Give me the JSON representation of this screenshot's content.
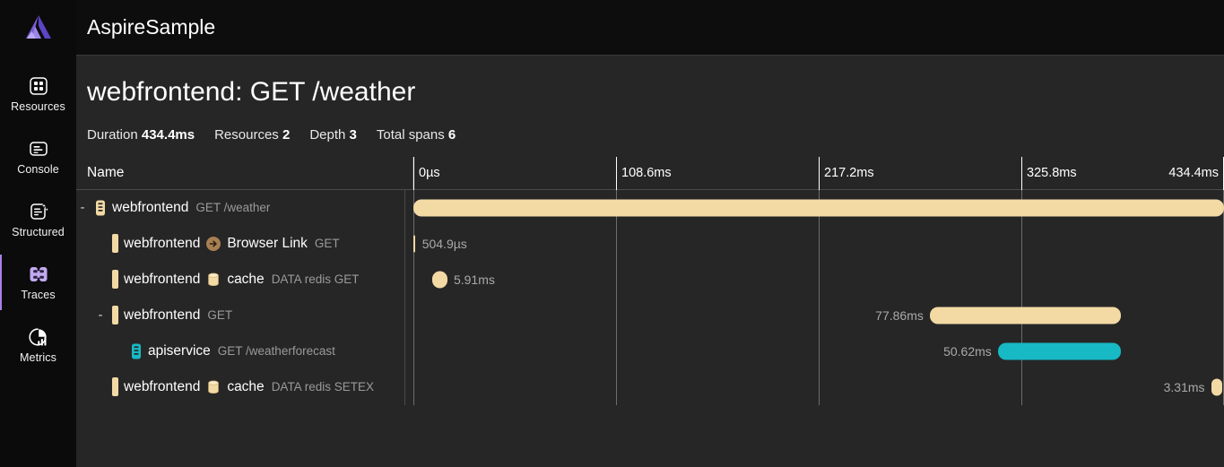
{
  "brand": {
    "logo_icon": "aspire-logo-icon",
    "accent": "#7c5cd6"
  },
  "sidebar": {
    "items": [
      {
        "label": "Resources",
        "icon": "resources-grid-icon",
        "active": false
      },
      {
        "label": "Console",
        "icon": "console-lines-icon",
        "active": false
      },
      {
        "label": "Structured",
        "icon": "structured-logs-sparkle-icon",
        "active": false
      },
      {
        "label": "Traces",
        "icon": "traces-link-icon",
        "active": true
      },
      {
        "label": "Metrics",
        "icon": "metrics-pie-chart-icon",
        "active": false
      }
    ]
  },
  "topbar": {
    "app_title": "AspireSample"
  },
  "page": {
    "title": "webfrontend: GET /weather",
    "meta": [
      {
        "label": "Duration",
        "value": "434.4ms"
      },
      {
        "label": "Resources",
        "value": "2"
      },
      {
        "label": "Depth",
        "value": "3"
      },
      {
        "label": "Total spans",
        "value": "6"
      }
    ]
  },
  "grid": {
    "name_column_header": "Name",
    "ticks": [
      "0µs",
      "108.6ms",
      "217.2ms",
      "325.8ms",
      "434.4ms"
    ],
    "colors": {
      "span_tan": "#f3d9a4",
      "span_teal": "#17b9c4",
      "arrow_brown": "#a87f52",
      "gridline": "#6d6d6d"
    },
    "rows": [
      {
        "expander": "-",
        "indent": 0,
        "icon": "resource-webfrontend-icon",
        "icon_kind": "service",
        "icon_color": "#f3d9a4",
        "name": "webfrontend",
        "mid_icon": null,
        "mid_icon_kind": null,
        "mid_name": null,
        "sub": "GET /weather",
        "bar": {
          "left_pct": 0.0,
          "width_pct": 100.0,
          "color": "#f3d9a4",
          "label": "",
          "label_side": "none"
        }
      },
      {
        "expander": "",
        "indent": 1,
        "icon": "span-bar-icon",
        "icon_kind": "spanbar",
        "icon_color": "#f3d9a4",
        "name": "webfrontend",
        "mid_icon": "arrow-right-circle-icon",
        "mid_icon_kind": "arrow",
        "mid_name": "Browser Link",
        "sub": "GET",
        "bar": {
          "left_pct": 0.0,
          "width_pct": 0.2,
          "color": "#f3d9a4",
          "label": "504.9µs",
          "label_side": "right"
        }
      },
      {
        "expander": "",
        "indent": 1,
        "icon": "span-bar-icon",
        "icon_kind": "spanbar",
        "icon_color": "#f3d9a4",
        "name": "webfrontend",
        "mid_icon": "redis-database-icon",
        "mid_icon_kind": "db",
        "mid_name": "cache",
        "sub": "DATA redis GET",
        "bar": {
          "left_pct": 2.3,
          "width_pct": 1.9,
          "color": "#f3d9a4",
          "label": "5.91ms",
          "label_side": "right"
        }
      },
      {
        "expander": "-",
        "indent": 1,
        "icon": "span-bar-icon",
        "icon_kind": "spanbar",
        "icon_color": "#f3d9a4",
        "name": "webfrontend",
        "mid_icon": null,
        "mid_icon_kind": null,
        "mid_name": null,
        "sub": "GET",
        "bar": {
          "left_pct": 63.7,
          "width_pct": 23.6,
          "color": "#f3d9a4",
          "label": "77.86ms",
          "label_side": "left"
        }
      },
      {
        "expander": "",
        "indent": 2,
        "icon": "resource-apiservice-icon",
        "icon_kind": "service",
        "icon_color": "#17b9c4",
        "name": "apiservice",
        "mid_icon": null,
        "mid_icon_kind": null,
        "mid_name": null,
        "sub": "GET /weatherforecast",
        "bar": {
          "left_pct": 72.1,
          "width_pct": 15.2,
          "color": "#17b9c4",
          "label": "50.62ms",
          "label_side": "left"
        }
      },
      {
        "expander": "",
        "indent": 1,
        "icon": "span-bar-icon",
        "icon_kind": "spanbar",
        "icon_color": "#f3d9a4",
        "name": "webfrontend",
        "mid_icon": "redis-database-icon",
        "mid_icon_kind": "db",
        "mid_name": "cache",
        "sub": "DATA redis SETEX",
        "bar": {
          "left_pct": 98.4,
          "width_pct": 1.1,
          "color": "#f3d9a4",
          "label": "3.31ms",
          "label_side": "left"
        }
      }
    ]
  }
}
